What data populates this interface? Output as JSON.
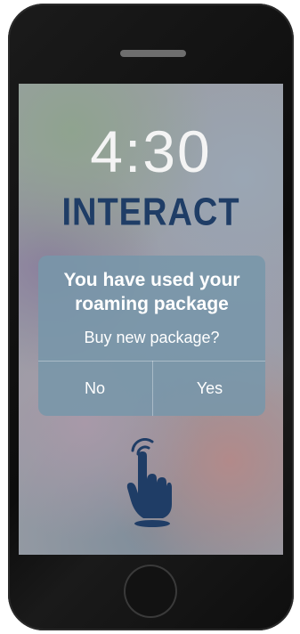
{
  "lockscreen": {
    "time": "4:30",
    "brand": "INTERACT"
  },
  "alert": {
    "title": "You have used your roaming package",
    "message": "Buy new package?",
    "buttons": {
      "no": "No",
      "yes": "Yes"
    }
  },
  "icons": {
    "hand": "tap-hand-icon"
  },
  "colors": {
    "brand": "#1f3d66",
    "dialog_bg": "#7896aa",
    "hand": "#1f3d66"
  }
}
